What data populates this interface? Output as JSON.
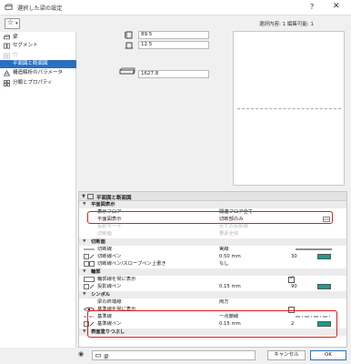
{
  "window": {
    "title": "選択した梁の設定",
    "help_label": "?",
    "close_label": "✕",
    "selection_info": "選択内容: 1 編集可能: 1"
  },
  "sidebar": {
    "items": [
      {
        "label": "梁",
        "icon": "beam-icon",
        "state": "normal"
      },
      {
        "label": "セグメント",
        "icon": "segment-icon",
        "state": "normal"
      },
      {
        "label": "穴",
        "icon": "hole-icon",
        "state": "disabled"
      },
      {
        "label": "平面図と断面図",
        "icon": "",
        "state": "selected"
      },
      {
        "label": "構造解析のパラメータ",
        "icon": "structure-icon",
        "state": "normal"
      },
      {
        "label": "分類とプロパティ",
        "icon": "classify-icon",
        "state": "normal"
      }
    ]
  },
  "geometry": {
    "height_value": "89.5",
    "offset_value": "12.5",
    "length_value": "1627.8"
  },
  "props": {
    "section_title": "平面図と断面図",
    "rows": [
      {
        "kind": "group",
        "name": "平面図表示"
      },
      {
        "kind": "row",
        "name": "表示フロア",
        "value": "関連フロア全て",
        "dim": false
      },
      {
        "kind": "row",
        "name": "平面図表示",
        "value": "切断部のみ",
        "dim": false
      },
      {
        "kind": "row",
        "name": "投影モード",
        "value": "全ての投影線",
        "dim": true
      },
      {
        "kind": "row",
        "name": "切断面",
        "value": "要素全体",
        "dim": true
      },
      {
        "kind": "group",
        "name": "切断面"
      },
      {
        "kind": "row",
        "name": "切断線",
        "value": "実線",
        "dim": false
      },
      {
        "kind": "row",
        "name": "切断線ペン",
        "value": "0.50 mm",
        "dim": false,
        "num": "30"
      },
      {
        "kind": "row",
        "name": "切断線ペン/スロープペン上書き",
        "value": "なし",
        "dim": false
      },
      {
        "kind": "group",
        "name": "輪郭"
      },
      {
        "kind": "row",
        "name": "輪郭線を常に表示",
        "value": "",
        "dim": false,
        "check": true
      },
      {
        "kind": "row",
        "name": "投影線ペン",
        "value": "0.15 mm",
        "dim": false,
        "num": "90"
      },
      {
        "kind": "group",
        "name": "シンボル"
      },
      {
        "kind": "row",
        "name": "梁の終端線",
        "value": "両方",
        "dim": false
      },
      {
        "kind": "row",
        "name": "基準線を常に表示",
        "value": "",
        "dim": false,
        "check": false
      },
      {
        "kind": "row",
        "name": "基準線",
        "value": "一点鎖線",
        "dim": false
      },
      {
        "kind": "row",
        "name": "基準線ペン",
        "value": "0.15 mm",
        "dim": false,
        "num": "2"
      },
      {
        "kind": "group",
        "name": "表面塗りつぶし"
      }
    ]
  },
  "footer": {
    "favorite_label": "梁",
    "cancel_label": "キャンセル",
    "ok_label": "OK"
  },
  "colors": {
    "accent": "#2b6fc3",
    "highlight": "#e21a22",
    "pen_green": "#1a9c8f"
  }
}
